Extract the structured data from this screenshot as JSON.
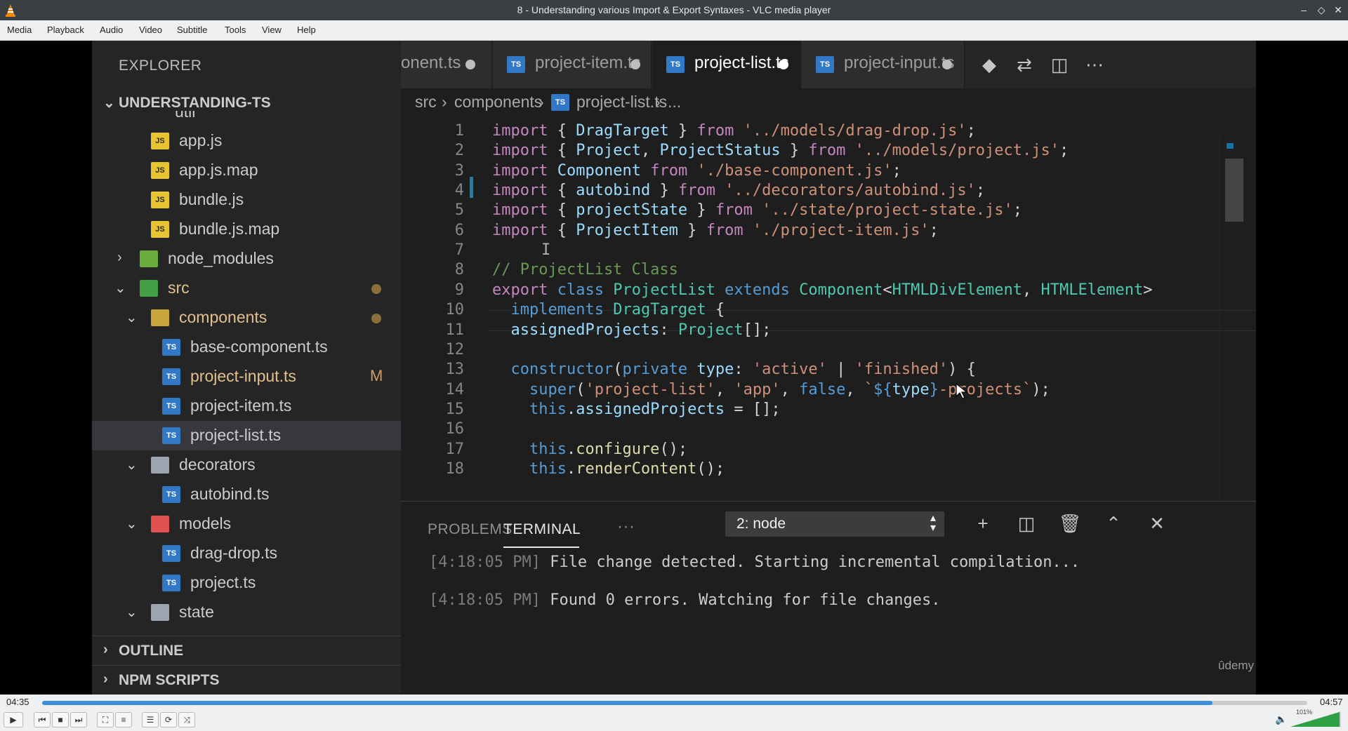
{
  "window": {
    "title": "8 - Understanding various Import & Export Syntaxes - VLC media player",
    "controls": [
      "–",
      "◇",
      "✕"
    ]
  },
  "menu": [
    "Media",
    "Playback",
    "Audio",
    "Video",
    "Subtitle",
    "Tools",
    "View",
    "Help"
  ],
  "explorer": {
    "title": "EXPLORER",
    "project": "UNDERSTANDING-TS",
    "partial_top": "util",
    "items": [
      {
        "label": "app.js",
        "type": "js"
      },
      {
        "label": "app.js.map",
        "type": "js"
      },
      {
        "label": "bundle.js",
        "type": "js"
      },
      {
        "label": "bundle.js.map",
        "type": "js"
      },
      {
        "label": "node_modules",
        "type": "folder"
      },
      {
        "label": "src",
        "type": "folder"
      },
      {
        "label": "components",
        "type": "folder"
      },
      {
        "label": "base-component.ts",
        "type": "ts"
      },
      {
        "label": "project-input.ts",
        "type": "ts",
        "badge": "M"
      },
      {
        "label": "project-item.ts",
        "type": "ts"
      },
      {
        "label": "project-list.ts",
        "type": "ts"
      },
      {
        "label": "decorators",
        "type": "folder"
      },
      {
        "label": "autobind.ts",
        "type": "ts"
      },
      {
        "label": "models",
        "type": "folder"
      },
      {
        "label": "drag-drop.ts",
        "type": "ts"
      },
      {
        "label": "project.ts",
        "type": "ts"
      },
      {
        "label": "state",
        "type": "folder"
      }
    ],
    "outline": "OUTLINE",
    "npm_scripts": "NPM SCRIPTS"
  },
  "tabs": [
    {
      "label": "onent.ts"
    },
    {
      "label": "project-item.ts"
    },
    {
      "label": "project-list.ts",
      "active": true
    },
    {
      "label": "project-input.ts"
    }
  ],
  "breadcrumb": [
    "src",
    "components",
    "project-list.ts",
    "..."
  ],
  "code": {
    "line_numbers": [
      "1",
      "2",
      "3",
      "4",
      "5",
      "6",
      "7",
      "8",
      "9",
      "10",
      "11",
      "12",
      "13",
      "14",
      "15",
      "16",
      "17",
      "18"
    ]
  },
  "panel": {
    "tabs": [
      "PROBLEMS",
      "TERMINAL",
      "···"
    ],
    "terminal_select": "2: node",
    "lines": [
      {
        "time": "[4:18:05 PM]",
        "text": " File change detected. Starting incremental compilation..."
      },
      {
        "time": "[4:18:05 PM]",
        "text": " Found 0 errors. Watching for file changes."
      }
    ],
    "watermark": "ûdemy"
  },
  "player": {
    "elapsed": "04:35",
    "total": "04:57",
    "progress_fraction": 0.925,
    "volume_label": "101%"
  },
  "colors": {
    "accent": "#3d8fd9",
    "editor_bg": "#1e1e1e",
    "sidebar_bg": "#252526"
  }
}
